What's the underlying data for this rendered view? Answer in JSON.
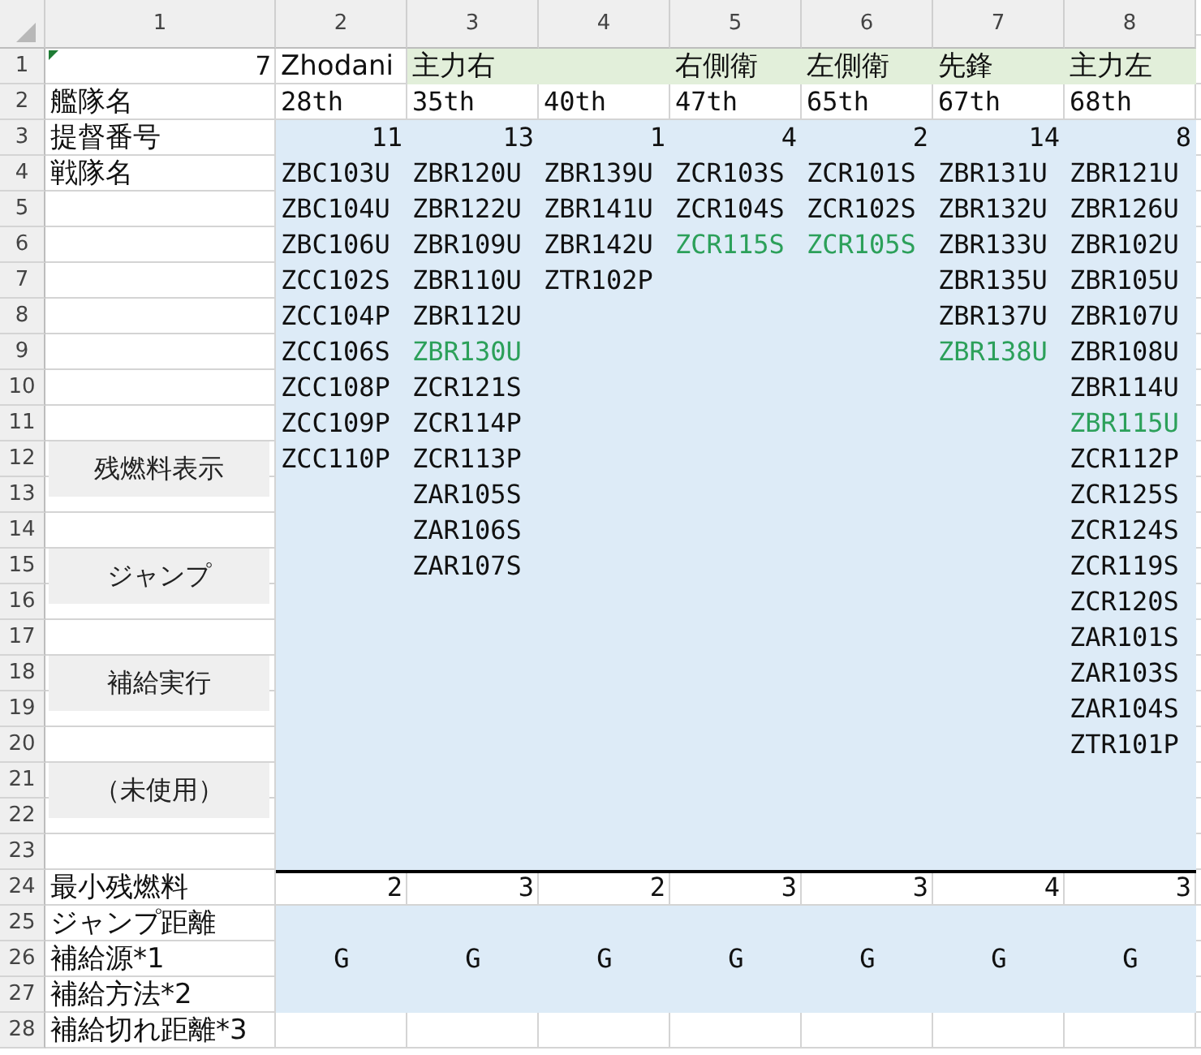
{
  "column_headers": [
    "1",
    "2",
    "3",
    "4",
    "5",
    "6",
    "7",
    "8"
  ],
  "row_headers": [
    "1",
    "2",
    "3",
    "4",
    "5",
    "6",
    "7",
    "8",
    "9",
    "10",
    "11",
    "12",
    "13",
    "14",
    "15",
    "16",
    "17",
    "18",
    "19",
    "20",
    "21",
    "22",
    "23",
    "24",
    "25",
    "26",
    "27",
    "28"
  ],
  "corner_value": "7",
  "labels": {
    "fleet_name": "艦隊名",
    "admiral_number": "提督番号",
    "squadron": "戦隊名"
  },
  "bottom_labels": [
    "最小残燃料",
    "ジャンプ距離",
    "補給源*1",
    "補給方法*2",
    "補給切れ距離*3"
  ],
  "buttons": [
    {
      "label": "残燃料表示"
    },
    {
      "label": "ジャンプ"
    },
    {
      "label": "補給実行"
    },
    {
      "label": "（未使用）"
    }
  ],
  "fleets": [
    {
      "group": "Zhodani",
      "shaded": false,
      "fleet": "28th",
      "admiral": "11",
      "squadrons": [
        {
          "code": "ZBC103U",
          "highlighted": false
        },
        {
          "code": "ZBC104U",
          "highlighted": false
        },
        {
          "code": "ZBC106U",
          "highlighted": false
        },
        {
          "code": "ZCC102S",
          "highlighted": false
        },
        {
          "code": "ZCC104P",
          "highlighted": false
        },
        {
          "code": "ZCC106S",
          "highlighted": false
        },
        {
          "code": "ZCC108P",
          "highlighted": false
        },
        {
          "code": "ZCC109P",
          "highlighted": false
        },
        {
          "code": "ZCC110P",
          "highlighted": false
        }
      ],
      "min_fuel": "2",
      "supply_source": "G"
    },
    {
      "group": "主力右",
      "shaded": true,
      "fleet": "35th",
      "admiral": "13",
      "squadrons": [
        {
          "code": "ZBR120U",
          "highlighted": false
        },
        {
          "code": "ZBR122U",
          "highlighted": false
        },
        {
          "code": "ZBR109U",
          "highlighted": false
        },
        {
          "code": "ZBR110U",
          "highlighted": false
        },
        {
          "code": "ZBR112U",
          "highlighted": false
        },
        {
          "code": "ZBR130U",
          "highlighted": true
        },
        {
          "code": "ZCR121S",
          "highlighted": false
        },
        {
          "code": "ZCR114P",
          "highlighted": false
        },
        {
          "code": "ZCR113P",
          "highlighted": false
        },
        {
          "code": "ZAR105S",
          "highlighted": false
        },
        {
          "code": "ZAR106S",
          "highlighted": false
        },
        {
          "code": "ZAR107S",
          "highlighted": false
        }
      ],
      "min_fuel": "3",
      "supply_source": "G"
    },
    {
      "shaded": true,
      "fleet": "40th",
      "admiral": "1",
      "squadrons": [
        {
          "code": "ZBR139U",
          "highlighted": false
        },
        {
          "code": "ZBR141U",
          "highlighted": false
        },
        {
          "code": "ZBR142U",
          "highlighted": false
        },
        {
          "code": "ZTR102P",
          "highlighted": false
        }
      ],
      "min_fuel": "2",
      "supply_source": "G"
    },
    {
      "group": "右側衛",
      "shaded": true,
      "fleet": "47th",
      "admiral": "4",
      "squadrons": [
        {
          "code": "ZCR103S",
          "highlighted": false
        },
        {
          "code": "ZCR104S",
          "highlighted": false
        },
        {
          "code": "ZCR115S",
          "highlighted": true
        }
      ],
      "min_fuel": "3",
      "supply_source": "G"
    },
    {
      "group": "左側衛",
      "shaded": true,
      "fleet": "65th",
      "admiral": "2",
      "squadrons": [
        {
          "code": "ZCR101S",
          "highlighted": false
        },
        {
          "code": "ZCR102S",
          "highlighted": false
        },
        {
          "code": "ZCR105S",
          "highlighted": true
        }
      ],
      "min_fuel": "3",
      "supply_source": "G"
    },
    {
      "group": "先鋒",
      "shaded": true,
      "fleet": "67th",
      "admiral": "14",
      "squadrons": [
        {
          "code": "ZBR131U",
          "highlighted": false
        },
        {
          "code": "ZBR132U",
          "highlighted": false
        },
        {
          "code": "ZBR133U",
          "highlighted": false
        },
        {
          "code": "ZBR135U",
          "highlighted": false
        },
        {
          "code": "ZBR137U",
          "highlighted": false
        },
        {
          "code": "ZBR138U",
          "highlighted": true
        }
      ],
      "min_fuel": "4",
      "supply_source": "G"
    },
    {
      "group": "主力左",
      "shaded": true,
      "fleet": "68th",
      "admiral": "8",
      "squadrons": [
        {
          "code": "ZBR121U",
          "highlighted": false
        },
        {
          "code": "ZBR126U",
          "highlighted": false
        },
        {
          "code": "ZBR102U",
          "highlighted": false
        },
        {
          "code": "ZBR105U",
          "highlighted": false
        },
        {
          "code": "ZBR107U",
          "highlighted": false
        },
        {
          "code": "ZBR108U",
          "highlighted": false
        },
        {
          "code": "ZBR114U",
          "highlighted": false
        },
        {
          "code": "ZBR115U",
          "highlighted": true
        },
        {
          "code": "ZCR112P",
          "highlighted": false
        },
        {
          "code": "ZCR125S",
          "highlighted": false
        },
        {
          "code": "ZCR124S",
          "highlighted": false
        },
        {
          "code": "ZCR119S",
          "highlighted": false
        },
        {
          "code": "ZCR120S",
          "highlighted": false
        },
        {
          "code": "ZAR101S",
          "highlighted": false
        },
        {
          "code": "ZAR103S",
          "highlighted": false
        },
        {
          "code": "ZAR104S",
          "highlighted": false
        },
        {
          "code": "ZTR101P",
          "highlighted": false
        }
      ],
      "min_fuel": "3",
      "supply_source": "G"
    }
  ]
}
